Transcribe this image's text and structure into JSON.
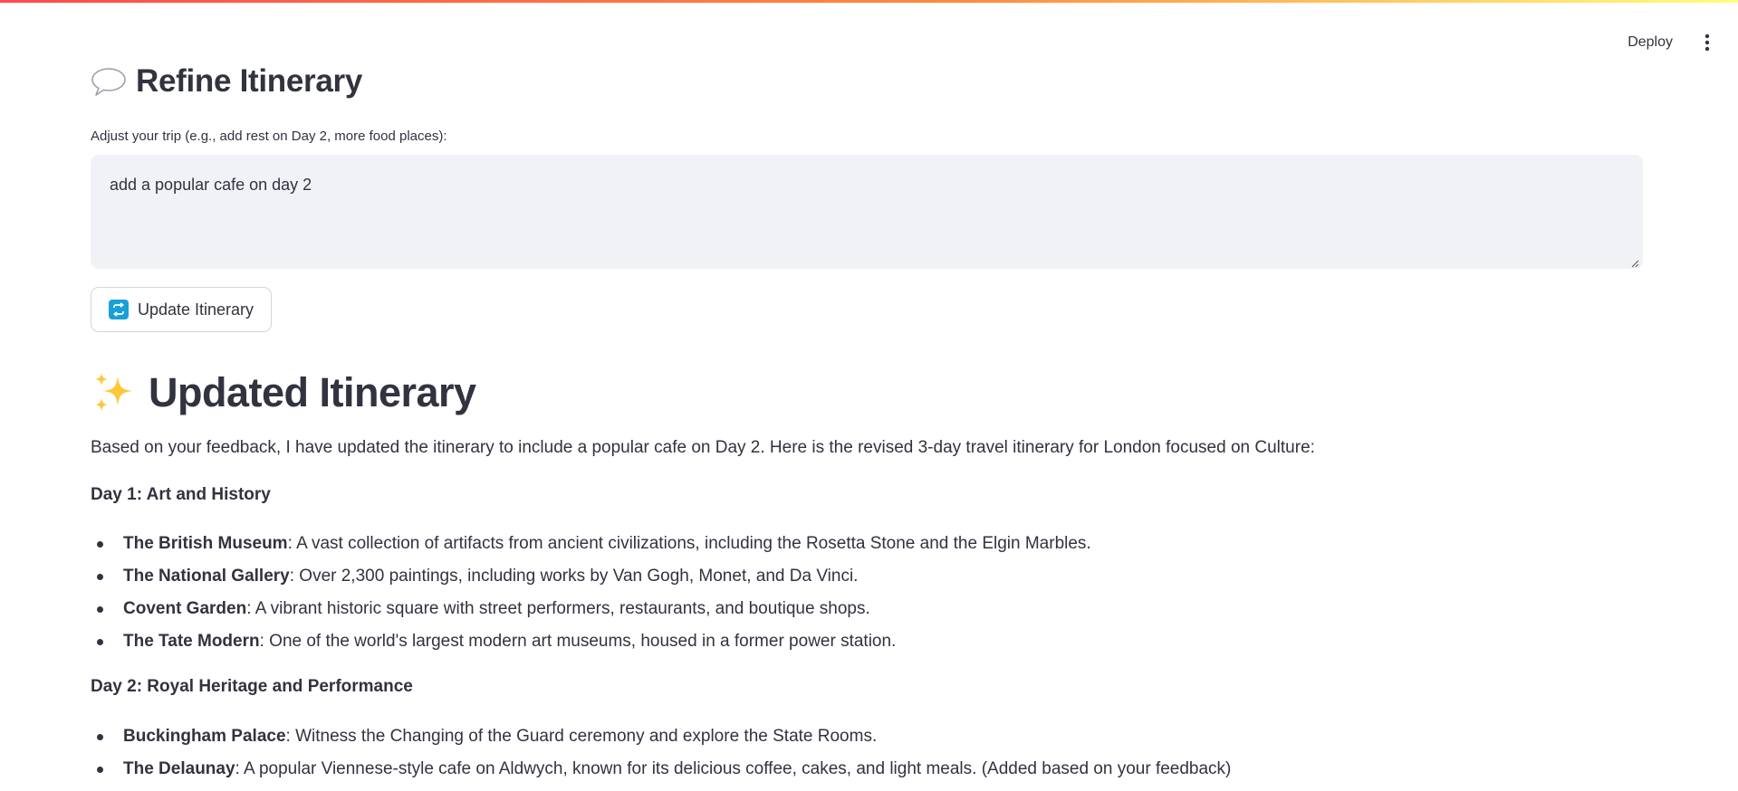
{
  "toolbar": {
    "deploy_label": "Deploy"
  },
  "refine": {
    "title": "Refine Itinerary",
    "title_icon": "speech-balloon-icon",
    "field_label": "Adjust your trip (e.g., add rest on Day 2, more food places):",
    "field_value": "add a popular cafe on day 2",
    "button_label": "Update Itinerary",
    "button_icon": "repeat-icon"
  },
  "result": {
    "title": "Updated Itinerary",
    "title_icon": "sparkles-icon",
    "intro": "Based on your feedback, I have updated the itinerary to include a popular cafe on Day 2. Here is the revised 3-day travel itinerary for London focused on Culture:",
    "days": [
      {
        "heading": "Day 1: Art and History",
        "items": [
          {
            "name": "The British Museum",
            "desc": ": A vast collection of artifacts from ancient civilizations, including the Rosetta Stone and the Elgin Marbles."
          },
          {
            "name": "The National Gallery",
            "desc": ": Over 2,300 paintings, including works by Van Gogh, Monet, and Da Vinci."
          },
          {
            "name": "Covent Garden",
            "desc": ": A vibrant historic square with street performers, restaurants, and boutique shops."
          },
          {
            "name": "The Tate Modern",
            "desc": ": One of the world's largest modern art museums, housed in a former power station."
          }
        ]
      },
      {
        "heading": "Day 2: Royal Heritage and Performance",
        "items": [
          {
            "name": "Buckingham Palace",
            "desc": ": Witness the Changing of the Guard ceremony and explore the State Rooms."
          },
          {
            "name": "The Delaunay",
            "desc": ": A popular Viennese-style cafe on Aldwych, known for its delicious coffee, cakes, and light meals. (Added based on your feedback)"
          }
        ]
      }
    ]
  },
  "colors": {
    "text": "#31333f",
    "input_bg": "#f0f2f6",
    "button_border": "#d4d6dc",
    "accent_gradient_start": "#ff4b4b",
    "accent_gradient_end": "#fffd80"
  }
}
